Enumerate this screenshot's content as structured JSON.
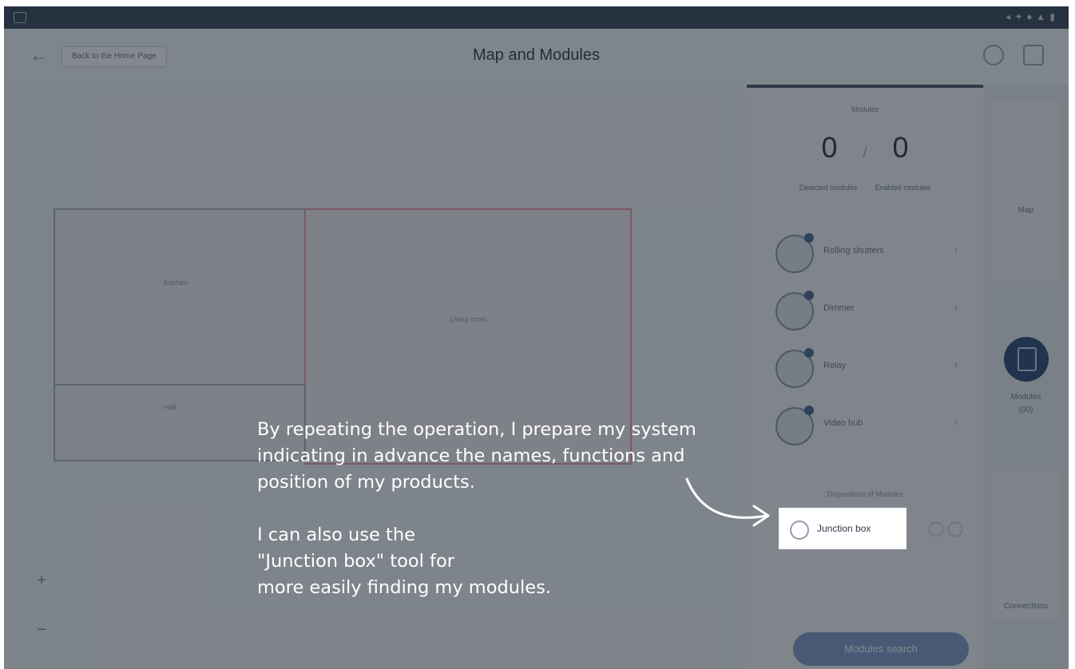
{
  "topbar": {
    "back_label": "Back to the Home Page",
    "title": "Map and Modules"
  },
  "map": {
    "rooms": [
      {
        "label": "Kitchen"
      },
      {
        "label": "Living room"
      },
      {
        "label": "Hall"
      }
    ],
    "zoom_in": "+",
    "zoom_out": "−"
  },
  "panel": {
    "modules_heading": "Modules",
    "count_detected": "0",
    "count_separator": "/",
    "count_enabled": "0",
    "label_detected": "Detected modules",
    "label_enabled": "Enabled modules",
    "items": [
      {
        "label": "Rolling shutters"
      },
      {
        "label": "Dimmer"
      },
      {
        "label": "Relay"
      },
      {
        "label": "Video hub"
      }
    ],
    "section_label": "Dispositions of Modules",
    "junction_label": "Junction box",
    "search_button": "Modules search"
  },
  "sidebar": {
    "map_label": "Map",
    "modules_label": "Modules",
    "modules_count": "(00)",
    "connections_label": "Connections"
  },
  "callout": {
    "paragraph1": "By repeating the operation, I prepare my system\nindicating in advance the names, functions and\nposition of my products.",
    "paragraph2": "I can also use the\n\"Junction box\" tool for\nmore easily finding my modules."
  }
}
